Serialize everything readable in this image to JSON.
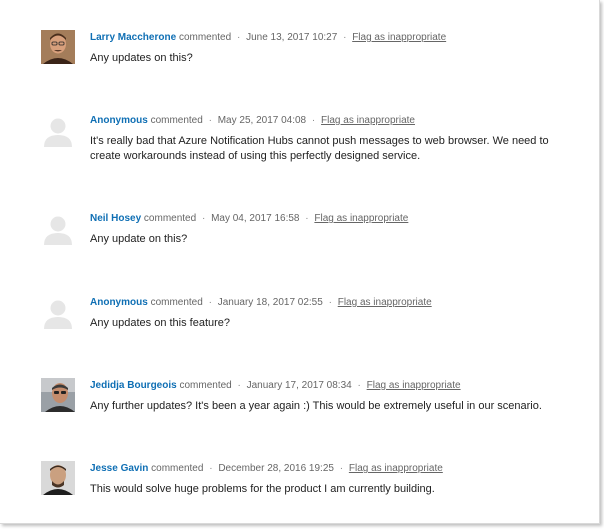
{
  "comments": [
    {
      "author": "Larry Maccherone",
      "verb": "commented",
      "date": "June 13, 2017 10:27",
      "flag": "Flag as inappropriate",
      "text": "Any updates on this?",
      "avatar": "photo"
    },
    {
      "author": "Anonymous",
      "verb": "commented",
      "date": "May 25, 2017 04:08",
      "flag": "Flag as inappropriate",
      "text": "It's really bad that Azure Notification Hubs cannot push messages to web browser. We need to create workarounds instead of using this perfectly designed service.",
      "avatar": "default-user-icon"
    },
    {
      "author": "Neil Hosey",
      "verb": "commented",
      "date": "May 04, 2017 16:58",
      "flag": "Flag as inappropriate",
      "text": "Any update on this?",
      "avatar": "default-user-icon"
    },
    {
      "author": "Anonymous",
      "verb": "commented",
      "date": "January 18, 2017 02:55",
      "flag": "Flag as inappropriate",
      "text": "Any updates on this feature?",
      "avatar": "default-user-icon"
    },
    {
      "author": "Jedidja Bourgeois",
      "verb": "commented",
      "date": "January 17, 2017 08:34",
      "flag": "Flag as inappropriate",
      "text": "Any further updates? It's been a year again :) This would be extremely useful in our scenario.",
      "avatar": "photo"
    },
    {
      "author": "Jesse Gavin",
      "verb": "commented",
      "date": "December 28, 2016 19:25",
      "flag": "Flag as inappropriate",
      "text": "This would solve huge problems for the product I am currently building.",
      "avatar": "photo"
    }
  ],
  "separator": "·",
  "colors": {
    "author_link": "#0f6fb4",
    "meta_text": "#666666",
    "body_text": "#222222",
    "avatar_placeholder": "#e6e6e6"
  }
}
